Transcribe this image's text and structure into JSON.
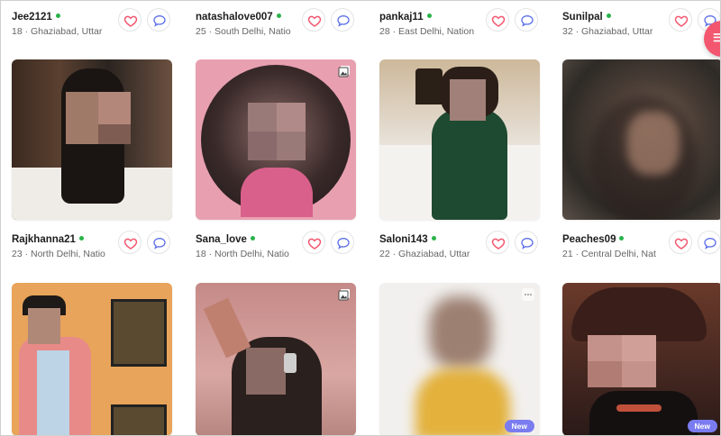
{
  "profiles": [
    {
      "username": "Jee2121",
      "meta": "18 · Ghaziabad, Uttar"
    },
    {
      "username": "natashalove007",
      "meta": "25 · South Delhi, Natio"
    },
    {
      "username": "pankaj11",
      "meta": "28 · East Delhi, Nation"
    },
    {
      "username": "Sunilpal",
      "meta": "32 · Ghaziabad, Uttar"
    },
    {
      "username": "Rajkhanna21",
      "meta": "23 · North Delhi, Natio"
    },
    {
      "username": "Sana_love",
      "meta": "18 · North Delhi, Natio"
    },
    {
      "username": "Saloni143",
      "meta": "22 · Ghaziabad, Uttar"
    },
    {
      "username": "Peaches09",
      "meta": "21 · Central Delhi, Nat"
    }
  ],
  "badges": {
    "new": "New"
  },
  "fab": {
    "label": "☰"
  },
  "colors": {
    "accent": "#f2576f",
    "online": "#29b34a",
    "like_icon": "#f2576f",
    "message_icon": "#5b6ee8",
    "new_badge": "#7a7cf0"
  }
}
